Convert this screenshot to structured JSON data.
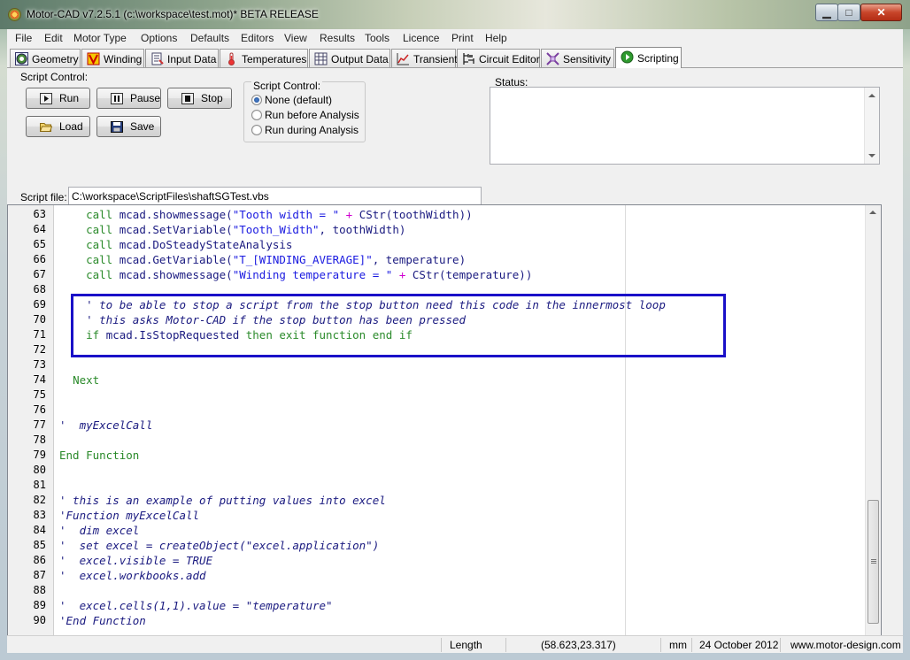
{
  "window": {
    "title": "Motor-CAD v7.2.5.1 (c:\\workspace\\test.mot)* BETA RELEASE",
    "minimize_glyph": "▁",
    "maximize_glyph": "□",
    "close_glyph": "✕"
  },
  "menubar": [
    "File",
    "Edit",
    "Motor Type",
    "Options",
    "Defaults",
    "Editors",
    "View",
    "Results",
    "Tools",
    "Licence",
    "Print",
    "Help"
  ],
  "tabs": [
    {
      "label": "Geometry",
      "icon": "geometry-icon"
    },
    {
      "label": "Winding",
      "icon": "winding-icon"
    },
    {
      "label": "Input Data",
      "icon": "input-data-icon"
    },
    {
      "label": "Temperatures",
      "icon": "thermometer-icon"
    },
    {
      "label": "Output Data",
      "icon": "output-data-icon"
    },
    {
      "label": "Transient",
      "icon": "transient-chart-icon"
    },
    {
      "label": "Circuit Editor",
      "icon": "circuit-icon"
    },
    {
      "label": "Sensitivity",
      "icon": "sensitivity-icon"
    },
    {
      "label": "Scripting",
      "icon": "scripting-icon",
      "active": true
    }
  ],
  "script_control": {
    "group_label": "Script Control:",
    "run_label": "Run",
    "pause_label": "Pause",
    "stop_label": "Stop",
    "load_label": "Load",
    "save_label": "Save",
    "mode_group_label": "Script Control:",
    "modes": [
      {
        "label": "None (default)",
        "checked": true
      },
      {
        "label": "Run before Analysis",
        "checked": false
      },
      {
        "label": "Run during Analysis",
        "checked": false
      }
    ]
  },
  "status": {
    "label": "Status:",
    "text": ""
  },
  "script_file": {
    "label": "Script file:",
    "value": "C:\\workspace\\ScriptFiles\\shaftSGTest.vbs"
  },
  "editor": {
    "lines": [
      {
        "n": "63",
        "tokens": [
          [
            "",
            "    "
          ],
          [
            "kw",
            "call "
          ],
          [
            "id",
            "mcad.showmessage("
          ],
          [
            "str",
            "\"Tooth width = \""
          ],
          [
            "op",
            " + "
          ],
          [
            "id",
            "CStr(toothWidth))"
          ]
        ]
      },
      {
        "n": "64",
        "tokens": [
          [
            "",
            "    "
          ],
          [
            "kw",
            "call "
          ],
          [
            "id",
            "mcad.SetVariable("
          ],
          [
            "str",
            "\"Tooth_Width\""
          ],
          [
            "id",
            ", toothWidth)"
          ]
        ]
      },
      {
        "n": "65",
        "tokens": [
          [
            "",
            "    "
          ],
          [
            "kw",
            "call "
          ],
          [
            "id",
            "mcad.DoSteadyStateAnalysis"
          ]
        ]
      },
      {
        "n": "66",
        "tokens": [
          [
            "",
            "    "
          ],
          [
            "kw",
            "call "
          ],
          [
            "id",
            "mcad.GetVariable("
          ],
          [
            "str",
            "\"T_[WINDING_AVERAGE]\""
          ],
          [
            "id",
            ", temperature)"
          ]
        ]
      },
      {
        "n": "67",
        "tokens": [
          [
            "",
            "    "
          ],
          [
            "kw",
            "call "
          ],
          [
            "id",
            "mcad.showmessage("
          ],
          [
            "str",
            "\"Winding temperature = \""
          ],
          [
            "op",
            " + "
          ],
          [
            "id",
            "CStr(temperature))"
          ]
        ]
      },
      {
        "n": "68",
        "tokens": []
      },
      {
        "n": "69",
        "tokens": [
          [
            "",
            "    "
          ],
          [
            "cm",
            "' to be able to stop a script from the stop button need this code in the innermost loop"
          ]
        ]
      },
      {
        "n": "70",
        "tokens": [
          [
            "",
            "    "
          ],
          [
            "cm",
            "' this asks Motor-CAD if the stop button has been pressed"
          ]
        ]
      },
      {
        "n": "71",
        "tokens": [
          [
            "",
            "  "
          ],
          [
            "kw",
            "  if "
          ],
          [
            "id",
            "mcad.IsStopRequested "
          ],
          [
            "kw",
            "then exit function end if"
          ]
        ]
      },
      {
        "n": "72",
        "tokens": []
      },
      {
        "n": "73",
        "tokens": []
      },
      {
        "n": "74",
        "tokens": [
          [
            "",
            "  "
          ],
          [
            "kw",
            "Next"
          ]
        ]
      },
      {
        "n": "75",
        "tokens": []
      },
      {
        "n": "76",
        "tokens": []
      },
      {
        "n": "77",
        "tokens": [
          [
            "cm",
            "'  myExcelCall"
          ]
        ]
      },
      {
        "n": "78",
        "tokens": []
      },
      {
        "n": "79",
        "tokens": [
          [
            "kw",
            "End Function"
          ]
        ]
      },
      {
        "n": "80",
        "tokens": []
      },
      {
        "n": "81",
        "tokens": []
      },
      {
        "n": "82",
        "tokens": [
          [
            "cm",
            "' this is an example of putting values into excel"
          ]
        ]
      },
      {
        "n": "83",
        "tokens": [
          [
            "cm",
            "'Function myExcelCall"
          ]
        ]
      },
      {
        "n": "84",
        "tokens": [
          [
            "cm",
            "'  dim excel"
          ]
        ]
      },
      {
        "n": "85",
        "tokens": [
          [
            "cm",
            "'  set excel = createObject(\"excel.application\")"
          ]
        ]
      },
      {
        "n": "86",
        "tokens": [
          [
            "cm",
            "'  excel.visible = TRUE"
          ]
        ]
      },
      {
        "n": "87",
        "tokens": [
          [
            "cm",
            "'  excel.workbooks.add"
          ]
        ]
      },
      {
        "n": "88",
        "tokens": []
      },
      {
        "n": "89",
        "tokens": [
          [
            "cm",
            "'  excel.cells(1,1).value = \"temperature\""
          ]
        ]
      },
      {
        "n": "90",
        "tokens": [
          [
            "cm",
            "'End Function"
          ]
        ]
      }
    ],
    "colors": {
      "keyword": "#2a8a2a",
      "identifier": "#1a1a80",
      "string": "#1a1ae0",
      "operator": "#d000d0",
      "highlight_border": "#1a10c8"
    }
  },
  "statusbar": {
    "field": "Length",
    "coords": "(58.623,23.317)",
    "units": "mm",
    "date": "24 October 2012",
    "website": "www.motor-design.com"
  }
}
